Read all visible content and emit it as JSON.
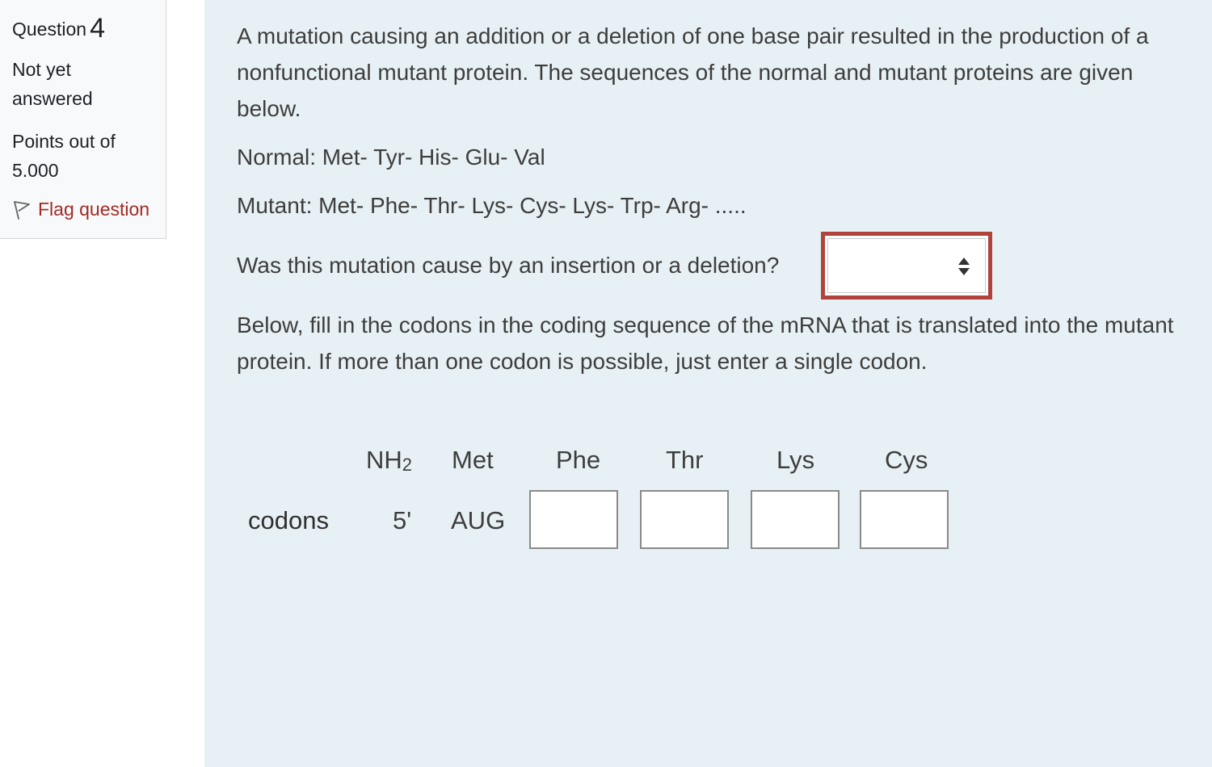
{
  "info": {
    "question_label": "Question",
    "question_number": "4",
    "state": "Not yet answered",
    "grade": "Points out of 5.000",
    "flag_label": "Flag question",
    "flag_icon": "flag-outline-icon"
  },
  "question": {
    "intro": "A mutation causing an addition or a deletion of one base pair resulted in the production of a nonfunctional mutant protein. The sequences of the normal and mutant proteins are given below.",
    "normal": "Normal: Met- Tyr- His- Glu- Val",
    "mutant": "Mutant: Met- Phe- Thr- Lys- Cys- Lys- Trp- Arg- .....",
    "ask": "Was this mutation cause by an insertion or a deletion?",
    "select_value": "",
    "select_icon": "select-arrows-icon",
    "instructions": "Below, fill in the codons in the coding sequence of the mRNA that is translated into the mutant protein. If more than one codon is possible, just enter a single codon."
  },
  "table": {
    "nh2_main": "NH",
    "nh2_sub": "2",
    "amino_acids": [
      "Met",
      "Phe",
      "Thr",
      "Lys",
      "Cys"
    ],
    "row_label": "codons",
    "five_prime": "5'",
    "first_codon": "AUG",
    "codon_inputs": [
      "",
      "",
      "",
      ""
    ]
  },
  "colors": {
    "content_bg": "#e7f1f5",
    "panel_bg": "#f8f9fa",
    "flag_text": "#a22a24",
    "select_border": "#b0443c",
    "text": "#3d3d3d"
  }
}
